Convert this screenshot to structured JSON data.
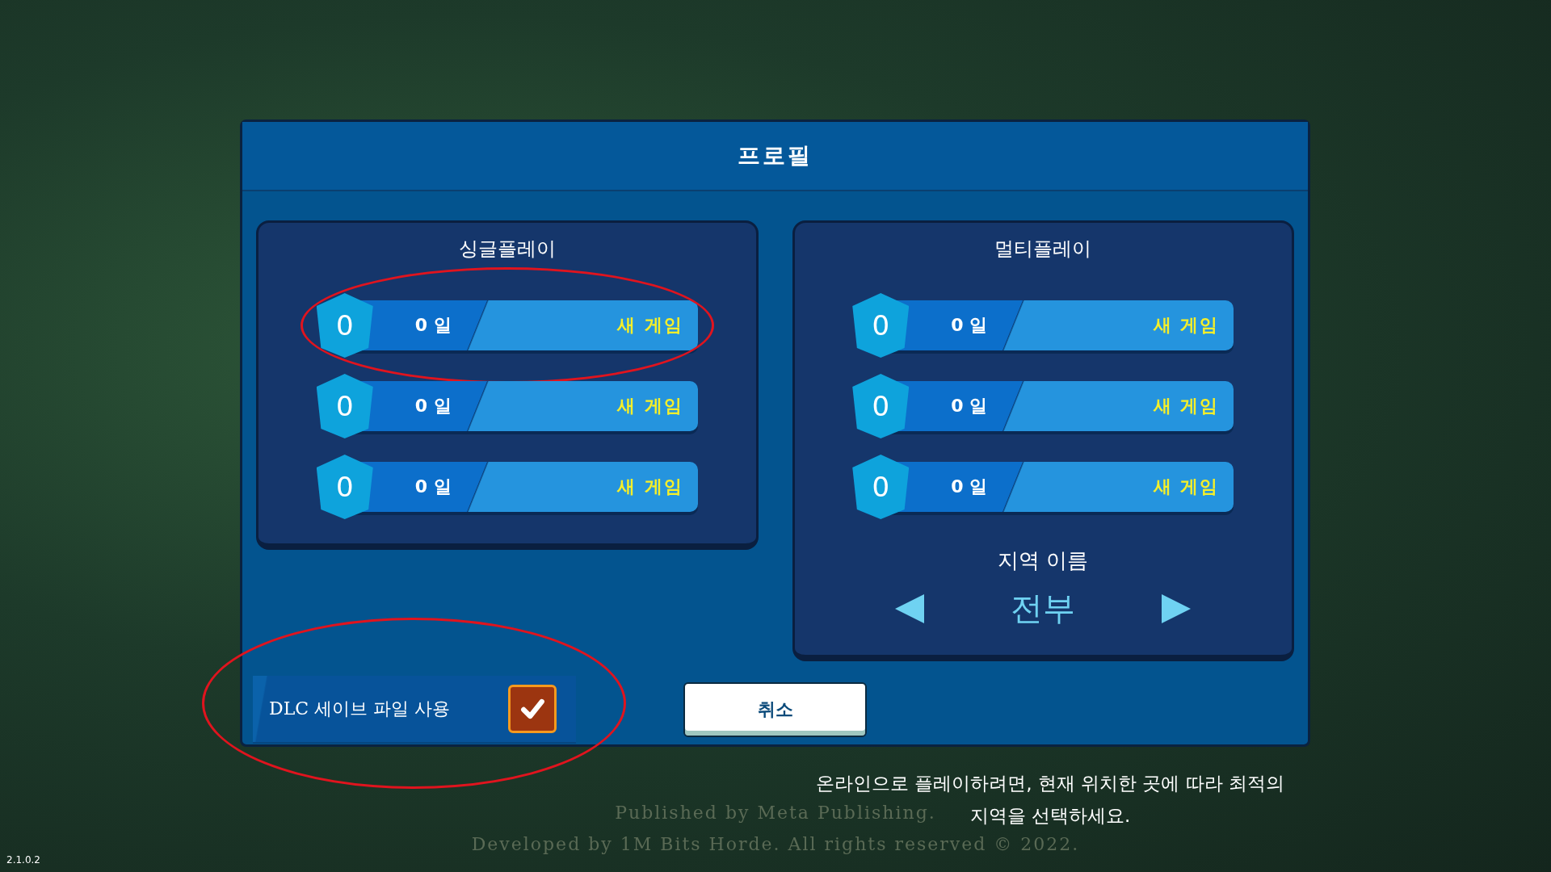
{
  "window": {
    "title": "프로필"
  },
  "single_play": {
    "title": "싱글플레이",
    "slots": [
      {
        "level": "0",
        "days": "0 일",
        "action": "새 게임",
        "circled": true
      },
      {
        "level": "0",
        "days": "0 일",
        "action": "새 게임",
        "circled": false
      },
      {
        "level": "0",
        "days": "0 일",
        "action": "새 게임",
        "circled": false
      }
    ]
  },
  "multi_play": {
    "title": "멀티플레이",
    "slots": [
      {
        "level": "0",
        "days": "0 일",
        "action": "새 게임",
        "circled": false
      },
      {
        "level": "0",
        "days": "0 일",
        "action": "새 게임",
        "circled": false
      },
      {
        "level": "0",
        "days": "0 일",
        "action": "새 게임",
        "circled": false
      }
    ],
    "region": {
      "label": "지역 이름",
      "value": "전부"
    }
  },
  "dlc_option": {
    "label": "DLC 세이브 파일 사용",
    "checked": true,
    "circled": true
  },
  "cancel_button": "취소",
  "notice": [
    "온라인으로 플레이하려면, 현재 위치한 곳에 따라 최적의",
    "지역을 선택하세요."
  ],
  "credits": [
    "Published by Meta Publishing.",
    "Developed by 1M Bits Horde. All rights reserved © 2022."
  ],
  "version": "2.1.0.2"
}
